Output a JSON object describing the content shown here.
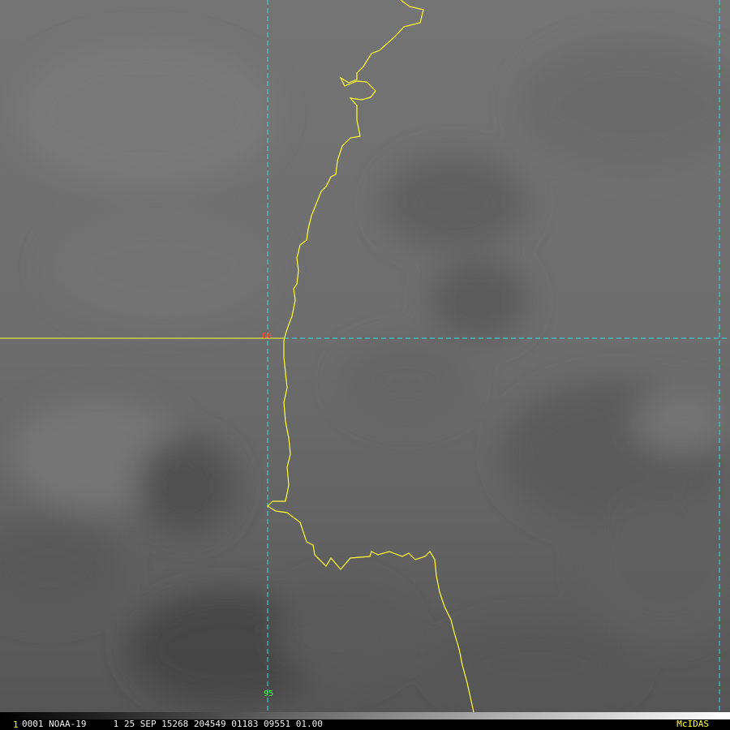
{
  "colors": {
    "coastline": "#ffff33",
    "gridline": "#33e0e0",
    "lat_label": "#ff4a2a",
    "lon_label": "#33ff33",
    "status_text": "#f2f2f2",
    "frame_number": "#ffff33",
    "brand": "#ffff33"
  },
  "map": {
    "latitude_label": "80",
    "longitude_label": "95",
    "coastline_icon": "coastline-line",
    "grid_icon": "dashed-grid-line"
  },
  "status": {
    "frame_number": "1",
    "text": "0001 NOAA-19     1 25 SEP 15268 204549 01183 09551 01.00",
    "brand": "McIDAS"
  }
}
